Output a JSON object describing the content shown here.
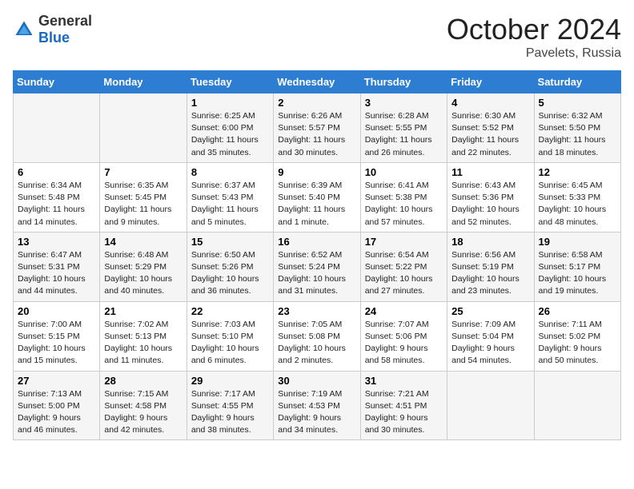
{
  "header": {
    "logo_general": "General",
    "logo_blue": "Blue",
    "month": "October 2024",
    "location": "Pavelets, Russia"
  },
  "weekdays": [
    "Sunday",
    "Monday",
    "Tuesday",
    "Wednesday",
    "Thursday",
    "Friday",
    "Saturday"
  ],
  "weeks": [
    [
      {
        "day": "",
        "info": ""
      },
      {
        "day": "",
        "info": ""
      },
      {
        "day": "1",
        "info": "Sunrise: 6:25 AM\nSunset: 6:00 PM\nDaylight: 11 hours and 35 minutes."
      },
      {
        "day": "2",
        "info": "Sunrise: 6:26 AM\nSunset: 5:57 PM\nDaylight: 11 hours and 30 minutes."
      },
      {
        "day": "3",
        "info": "Sunrise: 6:28 AM\nSunset: 5:55 PM\nDaylight: 11 hours and 26 minutes."
      },
      {
        "day": "4",
        "info": "Sunrise: 6:30 AM\nSunset: 5:52 PM\nDaylight: 11 hours and 22 minutes."
      },
      {
        "day": "5",
        "info": "Sunrise: 6:32 AM\nSunset: 5:50 PM\nDaylight: 11 hours and 18 minutes."
      }
    ],
    [
      {
        "day": "6",
        "info": "Sunrise: 6:34 AM\nSunset: 5:48 PM\nDaylight: 11 hours and 14 minutes."
      },
      {
        "day": "7",
        "info": "Sunrise: 6:35 AM\nSunset: 5:45 PM\nDaylight: 11 hours and 9 minutes."
      },
      {
        "day": "8",
        "info": "Sunrise: 6:37 AM\nSunset: 5:43 PM\nDaylight: 11 hours and 5 minutes."
      },
      {
        "day": "9",
        "info": "Sunrise: 6:39 AM\nSunset: 5:40 PM\nDaylight: 11 hours and 1 minute."
      },
      {
        "day": "10",
        "info": "Sunrise: 6:41 AM\nSunset: 5:38 PM\nDaylight: 10 hours and 57 minutes."
      },
      {
        "day": "11",
        "info": "Sunrise: 6:43 AM\nSunset: 5:36 PM\nDaylight: 10 hours and 52 minutes."
      },
      {
        "day": "12",
        "info": "Sunrise: 6:45 AM\nSunset: 5:33 PM\nDaylight: 10 hours and 48 minutes."
      }
    ],
    [
      {
        "day": "13",
        "info": "Sunrise: 6:47 AM\nSunset: 5:31 PM\nDaylight: 10 hours and 44 minutes."
      },
      {
        "day": "14",
        "info": "Sunrise: 6:48 AM\nSunset: 5:29 PM\nDaylight: 10 hours and 40 minutes."
      },
      {
        "day": "15",
        "info": "Sunrise: 6:50 AM\nSunset: 5:26 PM\nDaylight: 10 hours and 36 minutes."
      },
      {
        "day": "16",
        "info": "Sunrise: 6:52 AM\nSunset: 5:24 PM\nDaylight: 10 hours and 31 minutes."
      },
      {
        "day": "17",
        "info": "Sunrise: 6:54 AM\nSunset: 5:22 PM\nDaylight: 10 hours and 27 minutes."
      },
      {
        "day": "18",
        "info": "Sunrise: 6:56 AM\nSunset: 5:19 PM\nDaylight: 10 hours and 23 minutes."
      },
      {
        "day": "19",
        "info": "Sunrise: 6:58 AM\nSunset: 5:17 PM\nDaylight: 10 hours and 19 minutes."
      }
    ],
    [
      {
        "day": "20",
        "info": "Sunrise: 7:00 AM\nSunset: 5:15 PM\nDaylight: 10 hours and 15 minutes."
      },
      {
        "day": "21",
        "info": "Sunrise: 7:02 AM\nSunset: 5:13 PM\nDaylight: 10 hours and 11 minutes."
      },
      {
        "day": "22",
        "info": "Sunrise: 7:03 AM\nSunset: 5:10 PM\nDaylight: 10 hours and 6 minutes."
      },
      {
        "day": "23",
        "info": "Sunrise: 7:05 AM\nSunset: 5:08 PM\nDaylight: 10 hours and 2 minutes."
      },
      {
        "day": "24",
        "info": "Sunrise: 7:07 AM\nSunset: 5:06 PM\nDaylight: 9 hours and 58 minutes."
      },
      {
        "day": "25",
        "info": "Sunrise: 7:09 AM\nSunset: 5:04 PM\nDaylight: 9 hours and 54 minutes."
      },
      {
        "day": "26",
        "info": "Sunrise: 7:11 AM\nSunset: 5:02 PM\nDaylight: 9 hours and 50 minutes."
      }
    ],
    [
      {
        "day": "27",
        "info": "Sunrise: 7:13 AM\nSunset: 5:00 PM\nDaylight: 9 hours and 46 minutes."
      },
      {
        "day": "28",
        "info": "Sunrise: 7:15 AM\nSunset: 4:58 PM\nDaylight: 9 hours and 42 minutes."
      },
      {
        "day": "29",
        "info": "Sunrise: 7:17 AM\nSunset: 4:55 PM\nDaylight: 9 hours and 38 minutes."
      },
      {
        "day": "30",
        "info": "Sunrise: 7:19 AM\nSunset: 4:53 PM\nDaylight: 9 hours and 34 minutes."
      },
      {
        "day": "31",
        "info": "Sunrise: 7:21 AM\nSunset: 4:51 PM\nDaylight: 9 hours and 30 minutes."
      },
      {
        "day": "",
        "info": ""
      },
      {
        "day": "",
        "info": ""
      }
    ]
  ]
}
